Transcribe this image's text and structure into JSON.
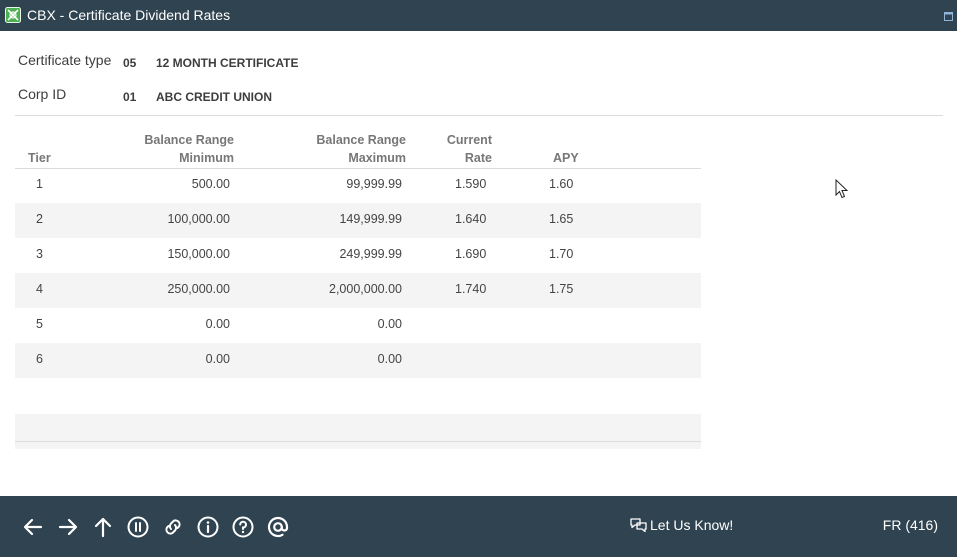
{
  "window": {
    "title": "CBX - Certificate Dividend Rates",
    "app_icon": "app-logo-icon",
    "maximize_icon": "maximize-icon"
  },
  "fields": {
    "certificate_type": {
      "label": "Certificate type",
      "code": "05",
      "value": "12 MONTH CERTIFICATE"
    },
    "corp_id": {
      "label": "Corp ID",
      "code": "01",
      "value": "ABC CREDIT UNION"
    }
  },
  "table": {
    "headers": {
      "tier": "Tier",
      "min_line1": "Balance Range",
      "min_line2": "Minimum",
      "max_line1": "Balance Range",
      "max_line2": "Maximum",
      "rate_line1": "Current",
      "rate_line2": "Rate",
      "apy": "APY"
    },
    "rows": [
      {
        "tier": "1",
        "min": "500.00",
        "max": "99,999.99",
        "rate": "1.590",
        "apy": "1.60"
      },
      {
        "tier": "2",
        "min": "100,000.00",
        "max": "149,999.99",
        "rate": "1.640",
        "apy": "1.65"
      },
      {
        "tier": "3",
        "min": "150,000.00",
        "max": "249,999.99",
        "rate": "1.690",
        "apy": "1.70"
      },
      {
        "tier": "4",
        "min": "250,000.00",
        "max": "2,000,000.00",
        "rate": "1.740",
        "apy": "1.75"
      },
      {
        "tier": "5",
        "min": "0.00",
        "max": "0.00",
        "rate": "",
        "apy": ""
      },
      {
        "tier": "6",
        "min": "0.00",
        "max": "0.00",
        "rate": "",
        "apy": ""
      }
    ]
  },
  "footer": {
    "buttons": [
      "back-arrow-icon",
      "forward-arrow-icon",
      "up-arrow-icon",
      "pause-icon",
      "link-icon",
      "info-icon",
      "help-icon",
      "at-sign-icon"
    ],
    "feedback_label": "Let Us Know!",
    "screen_id": "FR (416)"
  },
  "colors": {
    "header_bg": "#2f4350",
    "alt_row": "#f4f4f4",
    "text": "#3d3d3d"
  }
}
